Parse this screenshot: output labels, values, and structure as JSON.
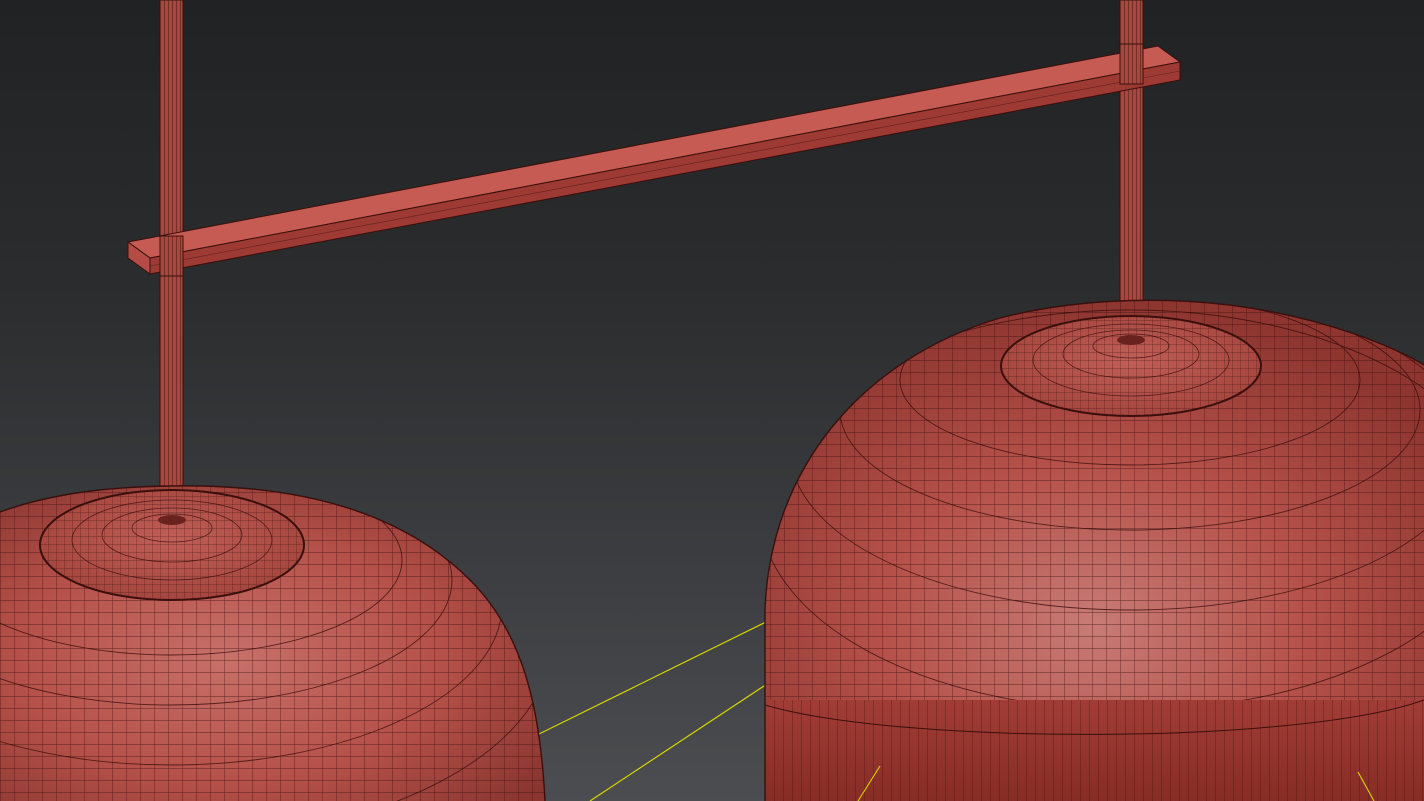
{
  "viewport": {
    "name": "3D viewport",
    "background_top": "#202224",
    "background_bottom": "#4b4d50"
  },
  "scene": {
    "objects": [
      {
        "name": "left-pendant-lamp",
        "kind": "pendant-shade"
      },
      {
        "name": "right-pendant-lamp",
        "kind": "pendant-shade"
      },
      {
        "name": "horizontal-bar",
        "kind": "box"
      },
      {
        "name": "left-rod",
        "kind": "cylinder"
      },
      {
        "name": "right-rod",
        "kind": "cylinder"
      }
    ],
    "colors": {
      "object_fill": "#b5514a",
      "object_dark": "#7a2a25",
      "wire_edges": "#3a0f0c",
      "helper_lines": "#d8d400"
    }
  }
}
